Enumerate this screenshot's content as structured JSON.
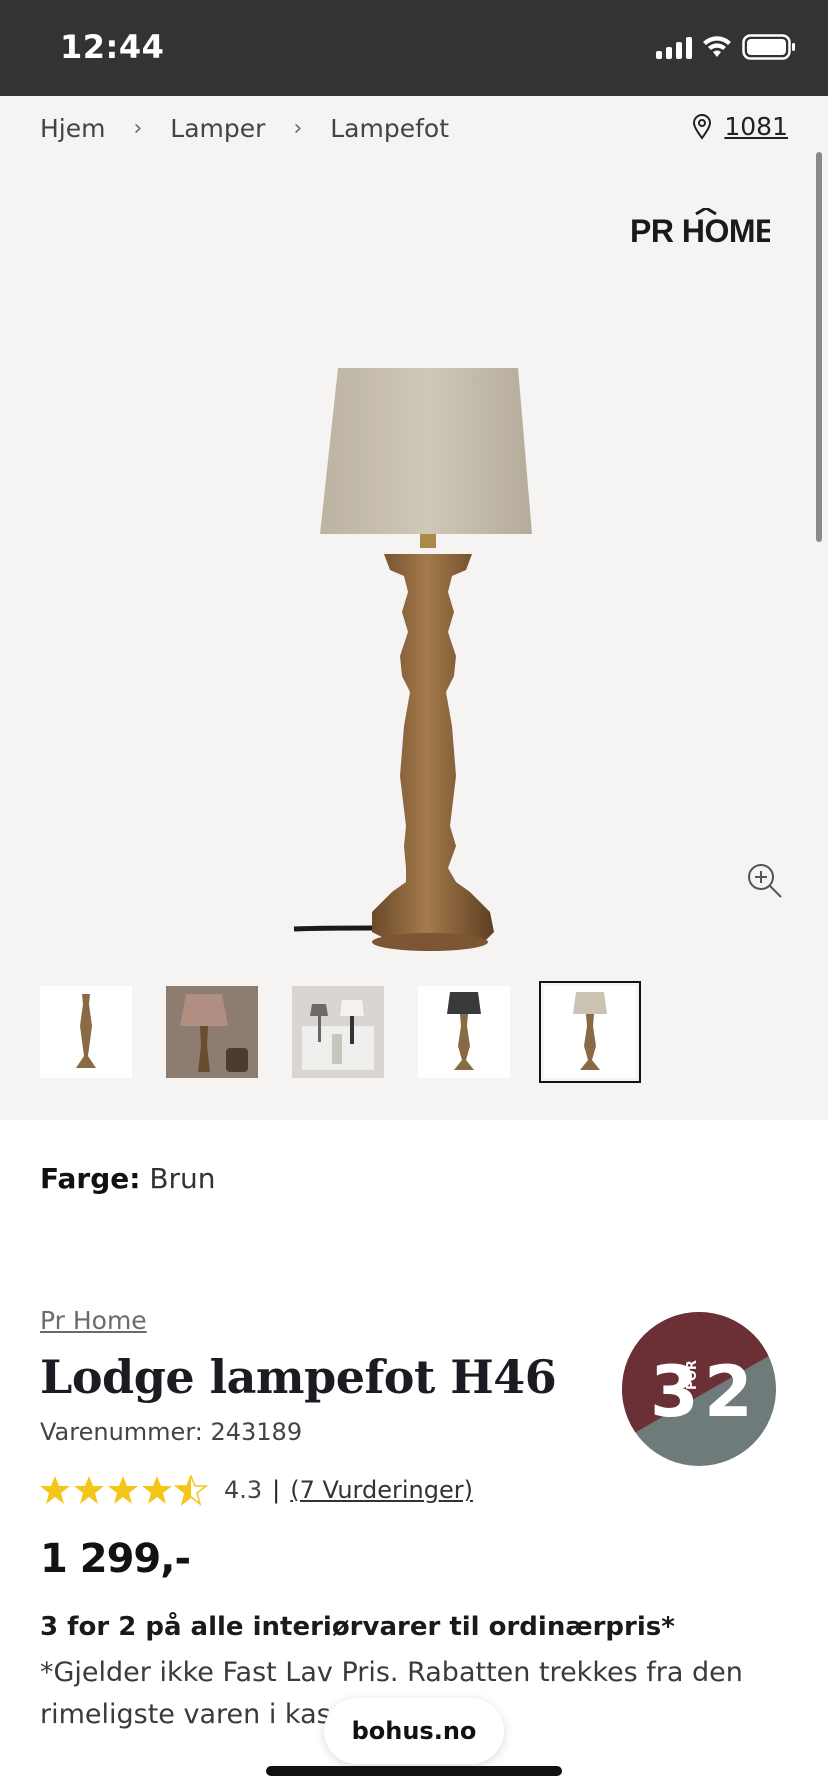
{
  "status_bar": {
    "time": "12:44"
  },
  "breadcrumb": {
    "items": [
      "Hjem",
      "Lamper",
      "Lampefot"
    ],
    "separator": "›"
  },
  "store": {
    "code": "1081"
  },
  "brand_logo": {
    "text": "PR HOME"
  },
  "gallery": {
    "thumb_count": 5,
    "selected_index": 4
  },
  "product": {
    "color_label": "Farge:",
    "color_value": "Brun",
    "brand": "Pr Home",
    "title": "Lodge lampefot H46",
    "sku": "Varenummer: 243189",
    "rating": {
      "value": 4.3,
      "stars": 4.5,
      "score_text": "4.3",
      "separator": "|",
      "reviews_text": "(7 Vurderinger)"
    },
    "price": "1 299,-",
    "promo_title": "3 for 2 på alle interiørvarer til ordinærpris*",
    "promo_text": "*Gjelder ikke Fast Lav Pris. Rabatten trekkes fra den rimeligste varen i kassen."
  },
  "badge": {
    "big_left": "3",
    "small": "FOR",
    "big_right": "2",
    "color_top": "#6b2f36",
    "color_bottom": "#6f7b7b"
  },
  "browser": {
    "url": "bohus.no"
  },
  "colors": {
    "gallery_bg": "#f5f4f2",
    "status_bg": "#333336",
    "star": "#f5c518"
  }
}
